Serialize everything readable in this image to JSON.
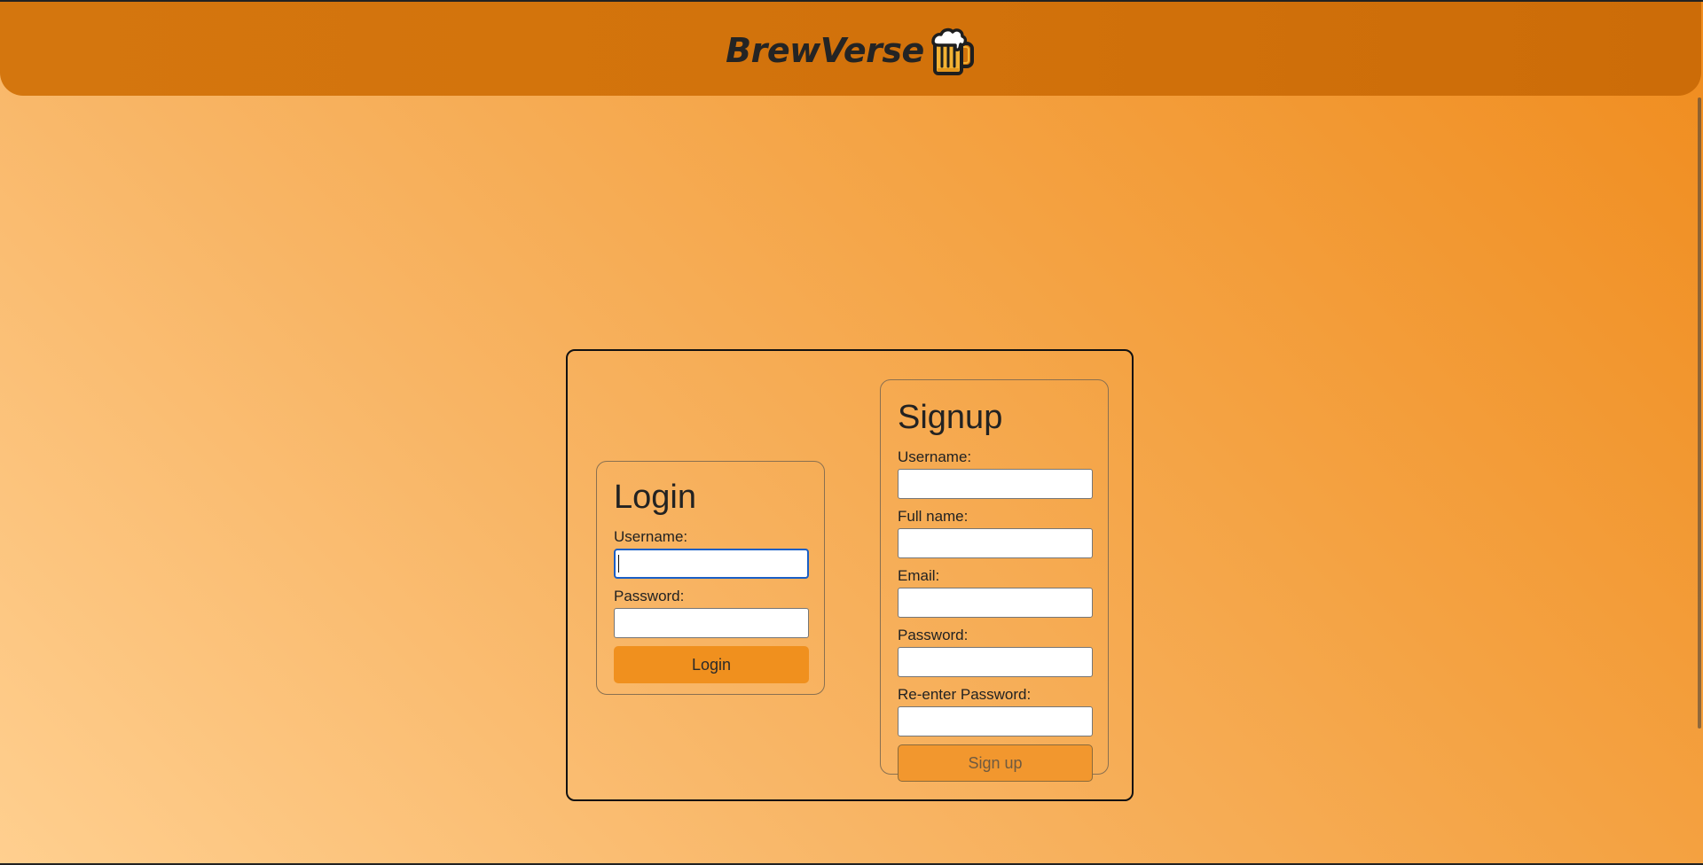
{
  "header": {
    "brand": "BrewVerse",
    "logo_icon": "beer-mug-icon"
  },
  "login": {
    "title": "Login",
    "username_label": "Username:",
    "username_value": "",
    "password_label": "Password:",
    "password_value": "",
    "button_label": "Login"
  },
  "signup": {
    "title": "Signup",
    "username_label": "Username:",
    "username_value": "",
    "fullname_label": "Full name:",
    "fullname_value": "",
    "email_label": "Email:",
    "email_value": "",
    "password_label": "Password:",
    "password_value": "",
    "reenter_label": "Re-enter Password:",
    "reenter_value": "",
    "button_label": "Sign up"
  },
  "colors": {
    "header": "#d2720b",
    "login_button": "#f0901e",
    "signup_button": "#f2972e",
    "focus_ring": "#1a5fc6"
  }
}
